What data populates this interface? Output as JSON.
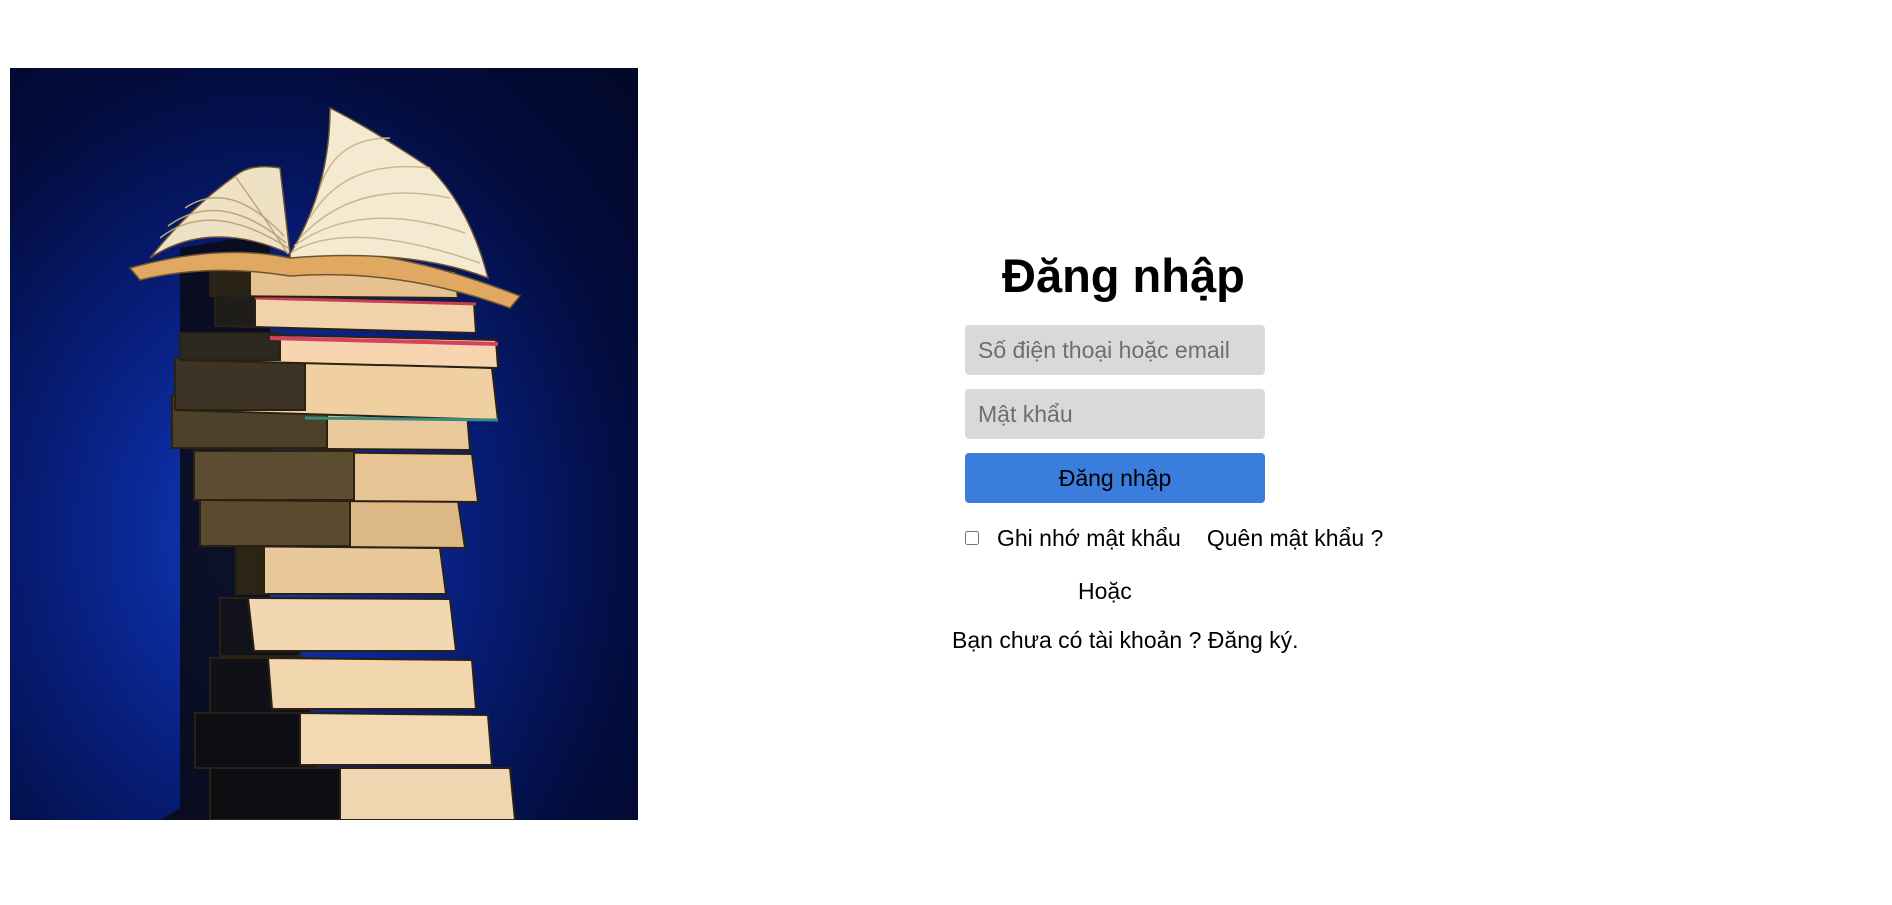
{
  "login_form": {
    "title": "Đăng nhập",
    "phone_placeholder": "Số điện thoại hoặc email",
    "password_placeholder": "Mật khẩu",
    "submit_label": "Đăng nhập",
    "remember_label": "Ghi nhớ mật khẩu",
    "remember_checked": false,
    "forgot_label": "Quên mật khẩu ?",
    "or_label": "Hoặc",
    "signup_prompt": "Bạn chưa có tài khoản ?",
    "signup_link": "Đăng ký."
  },
  "hero_image": {
    "subject": "stack-of-books-with-open-book",
    "background_color": "#0b2a9a"
  },
  "colors": {
    "button": "#3b7ddd",
    "input_bg": "#d9d9d9",
    "page_bg": "#ffffff"
  }
}
